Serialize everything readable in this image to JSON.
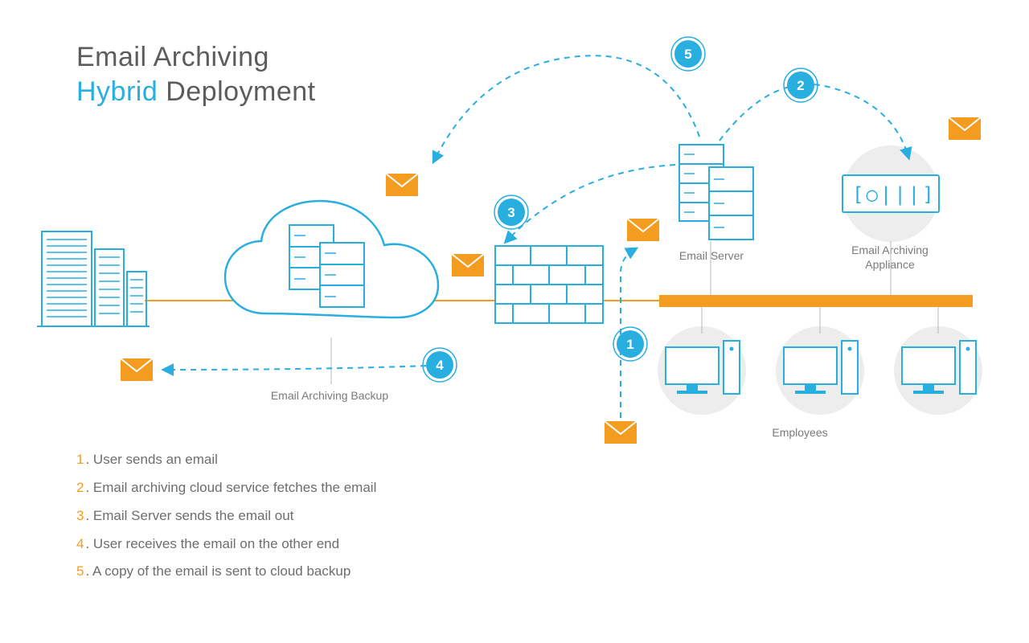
{
  "title": {
    "line1": "Email Archiving",
    "hybrid": "Hybrid",
    "line2_rest": " Deployment"
  },
  "labels": {
    "cloud": "Email Archiving Backup",
    "email_server": "Email Server",
    "appliance_l1": "Email Archiving",
    "appliance_l2": "Appliance",
    "employees": "Employees"
  },
  "steps": {
    "s1": {
      "num": "1",
      "text": "User sends an email"
    },
    "s2": {
      "num": "2",
      "text": "Email archiving cloud service fetches the email"
    },
    "s3": {
      "num": "3",
      "text": "Email Server sends the email out"
    },
    "s4": {
      "num": "4",
      "text": "User receives the email on the other end"
    },
    "s5": {
      "num": "5",
      "text": "A copy of the email is sent to cloud backup"
    }
  },
  "badges": {
    "b1": "1",
    "b2": "2",
    "b3": "3",
    "b4": "4",
    "b5": "5"
  },
  "colors": {
    "blue": "#29aee0",
    "orange": "#f39c1f",
    "grey": "#e9e9e9",
    "text": "#6d6d6d"
  }
}
